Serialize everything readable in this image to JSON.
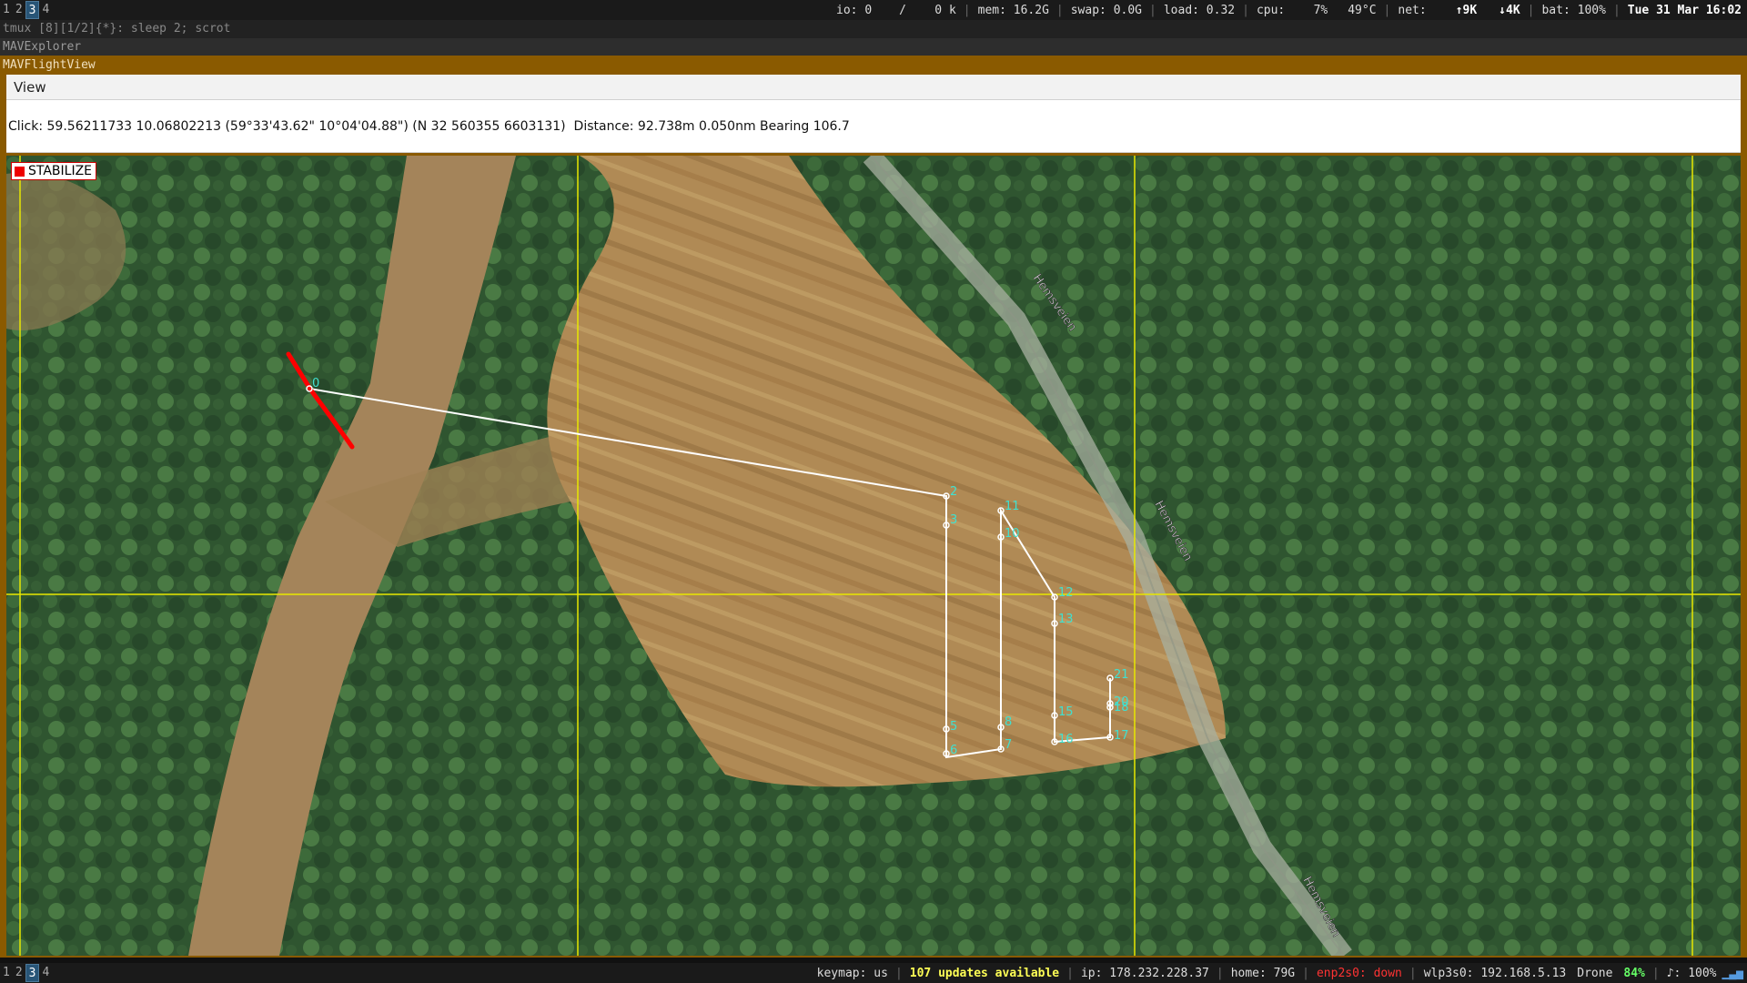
{
  "topbar": {
    "workspaces": [
      "1",
      "2",
      "3",
      "4"
    ],
    "active_workspace": "3",
    "io": "io: 0",
    "io_rate": "/    0 k",
    "mem": "mem: 16.2G",
    "swap": "swap: 0.0G",
    "load": "load: 0.32",
    "cpu": "cpu:    7%",
    "temp": "49°C",
    "net": "net:",
    "net_up": "↑9K",
    "net_down": "↓4K",
    "bat": "bat: 100%",
    "datetime": "Tue 31 Mar 16:02"
  },
  "windows": {
    "tmux_title": "tmux [8][1/2]{*}:  sleep 2; scrot",
    "explorer_title": "MAVExplorer",
    "flightview_title": "MAVFlightView"
  },
  "menu": {
    "view_label": "View"
  },
  "info": {
    "click_text": "Click: 59.56211733 10.06802213 (59°33'43.62\" 10°04'04.88\") (N 32 560355 6603131)  Distance: 92.738m 0.050nm Bearing 106.7"
  },
  "map": {
    "mode_label": "STABILIZE",
    "mode_color": "#e00000",
    "road_labels": [
      "Hemsveien",
      "Hemsveien",
      "Hemsveien"
    ],
    "waypoint_labels": [
      "0",
      "2",
      "3",
      "5",
      "6",
      "7",
      "8",
      "10",
      "11",
      "12",
      "13",
      "15",
      "16",
      "17",
      "18",
      "20",
      "21"
    ],
    "grid_color": "#e8e800",
    "path_color": "#ffffff",
    "label_color": "#40e0d0",
    "track_color": "#ff0000"
  },
  "bottombar": {
    "workspaces": [
      "1",
      "2",
      "3",
      "4"
    ],
    "active_workspace": "3",
    "keymap": "keymap: us",
    "updates": "107 updates available",
    "ip": "ip: 178.232.228.37",
    "home": "home: 79G",
    "enp": "enp2s0: down",
    "wlp": "wlp3s0: 192.168.5.13",
    "drone": "Drone",
    "drone_pct": "84%",
    "volume": "♪: 100%"
  }
}
